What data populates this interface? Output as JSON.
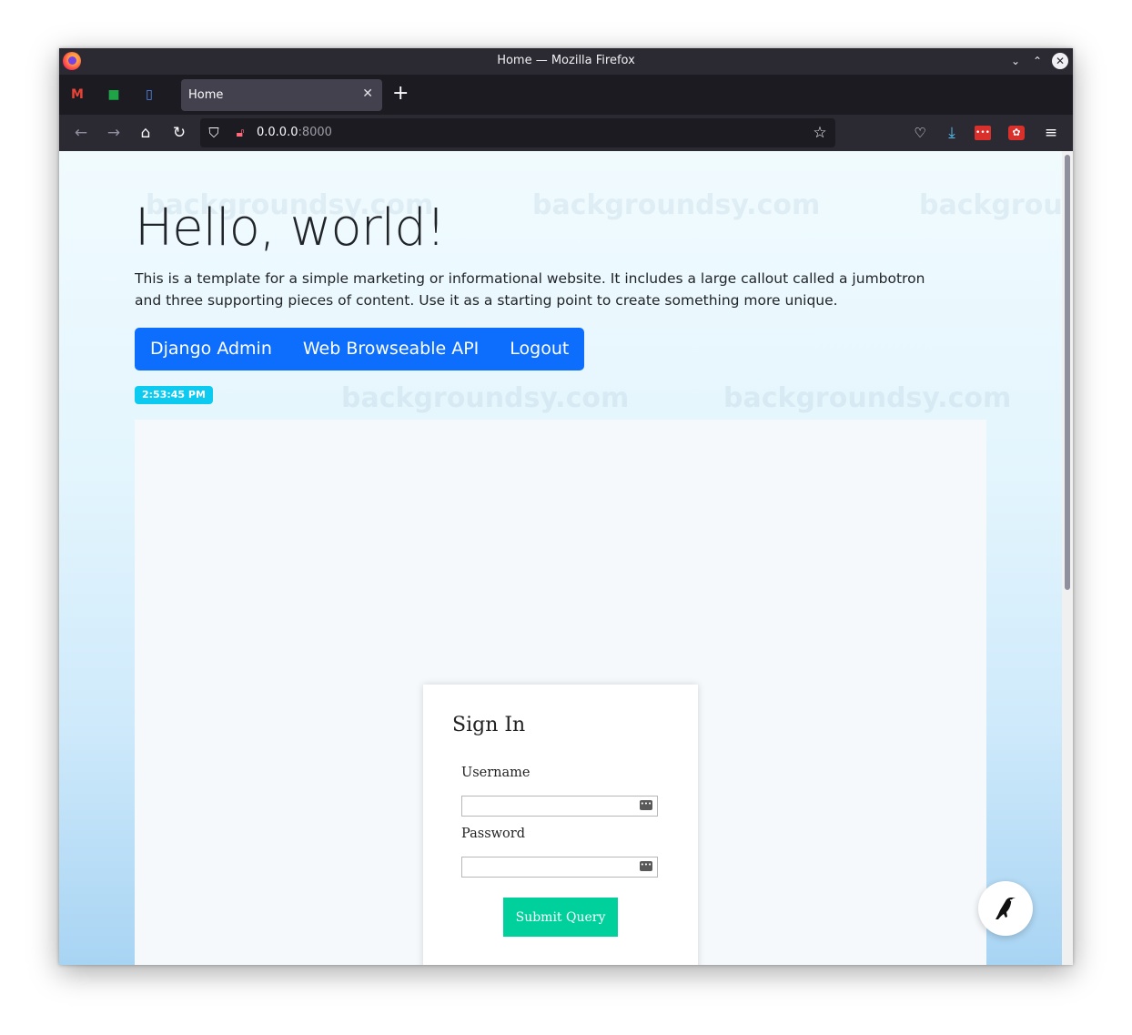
{
  "window": {
    "title": "Home — Mozilla Firefox"
  },
  "tabs": {
    "pinned": [
      {
        "name": "gmail",
        "glyph": "M",
        "color": "#ea4335"
      },
      {
        "name": "chat",
        "glyph": "■",
        "color": "#1ea446"
      },
      {
        "name": "workspace",
        "glyph": "▯",
        "color": "#4f8ff7"
      }
    ],
    "active_label": "Home",
    "close_glyph": "✕",
    "new_tab_glyph": "+"
  },
  "toolbar": {
    "url_host": "0.0.0.0",
    "url_port": ":8000"
  },
  "page": {
    "title": "Hello, world!",
    "lead": "This is a template for a simple marketing or informational website. It includes a large callout called a jumbotron and three supporting pieces of content. Use it as a starting point to create something more unique.",
    "buttons": [
      "Django Admin",
      "Web Browseable API",
      "Logout"
    ],
    "clock": "2:53:45 PM",
    "watermark": "backgroundsy.com"
  },
  "signin": {
    "heading": "Sign In",
    "username_label": "Username",
    "username_value": "",
    "password_label": "Password",
    "password_value": "",
    "submit_label": "Submit Query"
  },
  "colors": {
    "primary": "#0d6efd",
    "info": "#0dcaf0",
    "submit": "#00d09c"
  }
}
